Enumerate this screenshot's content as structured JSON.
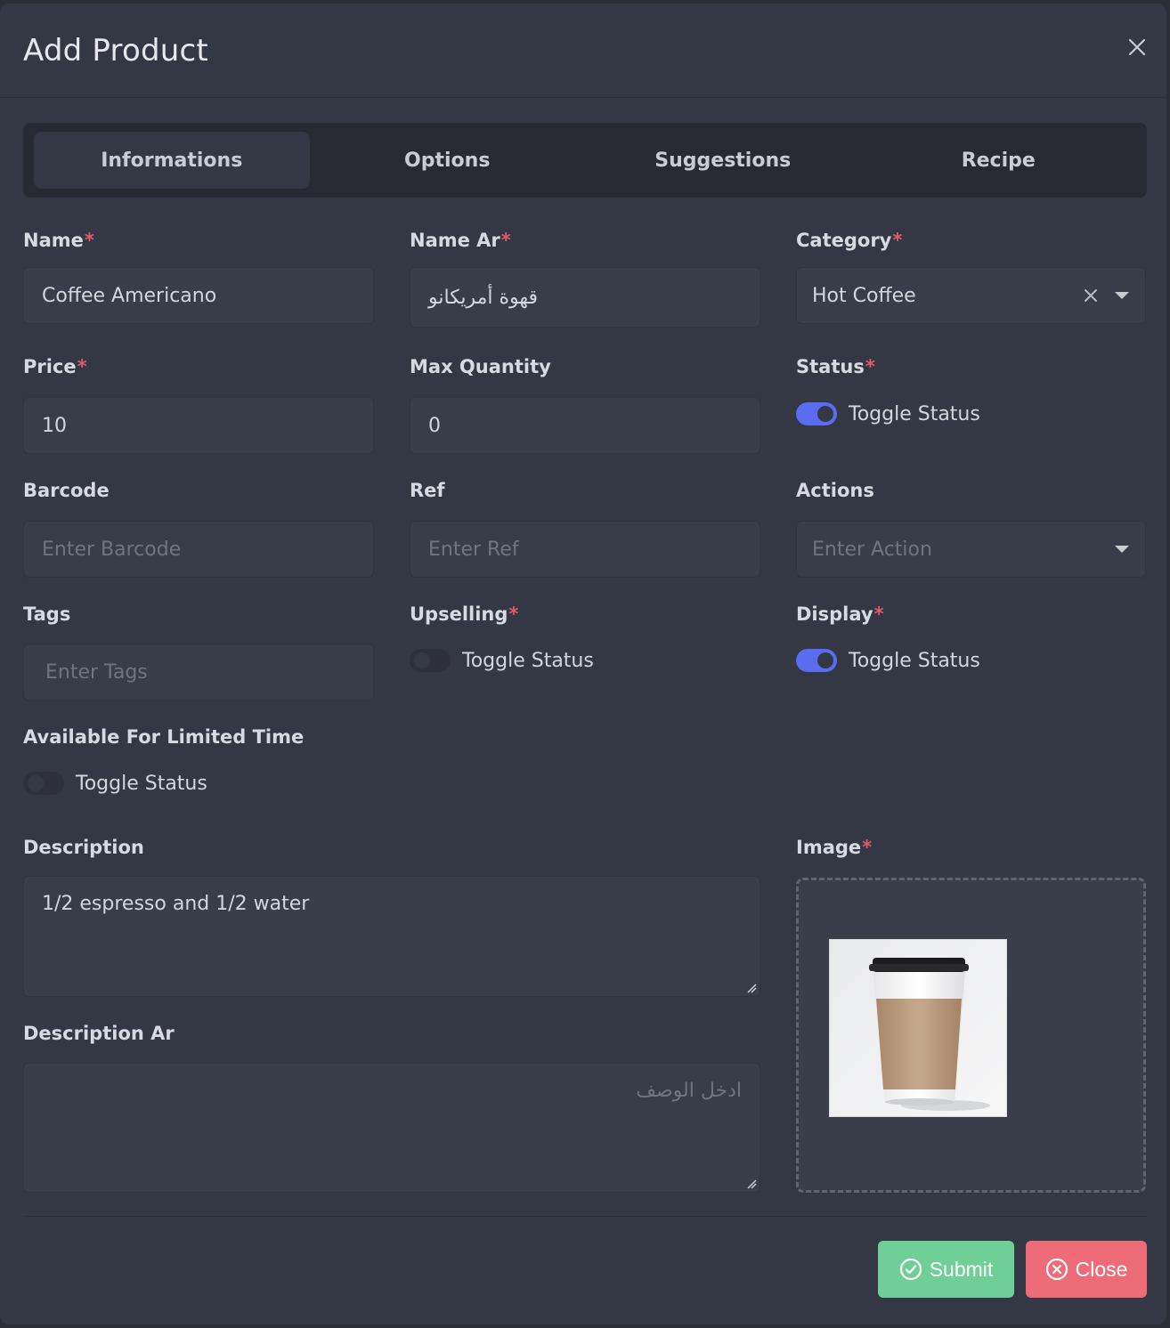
{
  "modal": {
    "title": "Add Product",
    "close_icon": "close-icon"
  },
  "tabs": [
    {
      "label": "Informations",
      "active": true
    },
    {
      "label": "Options",
      "active": false
    },
    {
      "label": "Suggestions",
      "active": false
    },
    {
      "label": "Recipe",
      "active": false
    }
  ],
  "fields": {
    "name": {
      "label": "Name",
      "required": "*",
      "value": "Coffee Americano"
    },
    "name_ar": {
      "label": "Name Ar",
      "required": "*",
      "value": "قهوة أمريكانو"
    },
    "category": {
      "label": "Category",
      "required": "*",
      "value": "Hot Coffee"
    },
    "price": {
      "label": "Price",
      "required": "*",
      "value": "10"
    },
    "max_quantity": {
      "label": "Max Quantity",
      "value": "0"
    },
    "status": {
      "label": "Status",
      "required": "*",
      "toggle_label": "Toggle Status",
      "on": true
    },
    "barcode": {
      "label": "Barcode",
      "placeholder": "Enter Barcode"
    },
    "ref": {
      "label": "Ref",
      "placeholder": "Enter Ref"
    },
    "actions": {
      "label": "Actions",
      "placeholder": "Enter Action"
    },
    "tags": {
      "label": "Tags",
      "placeholder": "Enter Tags"
    },
    "upselling": {
      "label": "Upselling",
      "required": "*",
      "toggle_label": "Toggle Status",
      "on": false
    },
    "display": {
      "label": "Display",
      "required": "*",
      "toggle_label": "Toggle Status",
      "on": true
    },
    "limited_time": {
      "label": "Available For Limited Time",
      "toggle_label": "Toggle Status",
      "on": false
    },
    "description": {
      "label": "Description",
      "value": "1/2 espresso and 1/2 water"
    },
    "description_ar": {
      "label": "Description Ar",
      "placeholder": "ادخل الوصف"
    },
    "image": {
      "label": "Image",
      "required": "*"
    }
  },
  "buttons": {
    "submit": "Submit",
    "close": "Close"
  },
  "colors": {
    "modal_bg": "#343844",
    "toggle_on": "#5a6cf0",
    "submit": "#6fcf97",
    "close": "#ee6b78",
    "required": "#e05a6a"
  }
}
